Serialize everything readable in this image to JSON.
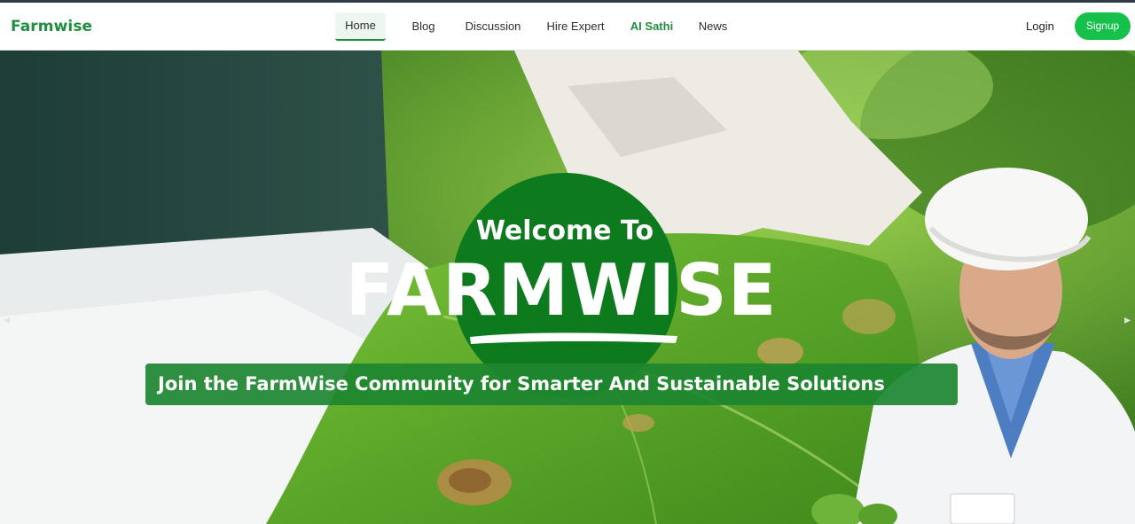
{
  "brand": "Farmwise",
  "nav": {
    "links": [
      {
        "label": "Home",
        "active": true
      },
      {
        "label": "Blog"
      },
      {
        "label": "Discussion"
      },
      {
        "label": "Hire Expert"
      },
      {
        "label": "AI Sathi",
        "highlight": true
      },
      {
        "label": "News"
      }
    ],
    "login": "Login",
    "signup": "Signup"
  },
  "hero": {
    "welcome": "Welcome To",
    "title": "FARMWISE",
    "tagline": "Join the FarmWise Community for Smarter And Sustainable Solutions",
    "prev_icon": "chevron-left-icon",
    "next_icon": "chevron-right-icon",
    "prev_glyph": "◂",
    "next_glyph": "▸"
  },
  "colors": {
    "brand": "#1f8f3f",
    "signup_bg": "#16c04a",
    "ribbon": "#1d8530",
    "circle": "#0e7a1e"
  }
}
